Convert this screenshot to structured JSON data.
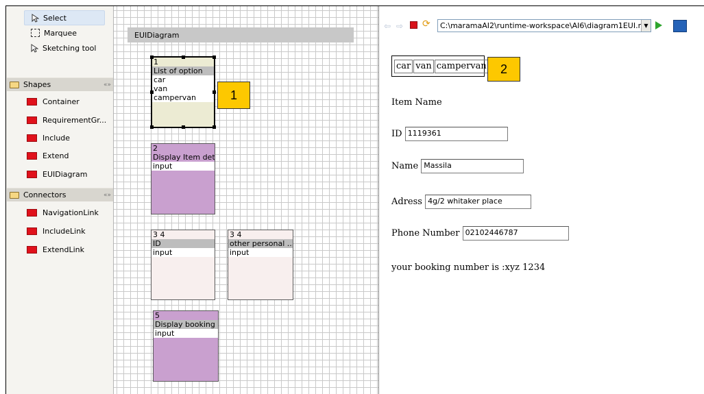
{
  "palette": {
    "tools": [
      {
        "label": "Select",
        "icon": "cursor-icon"
      },
      {
        "label": "Marquee",
        "icon": "marquee-icon"
      },
      {
        "label": "Sketching tool",
        "icon": "cursor-icon"
      }
    ],
    "shapes_drawer": "Shapes",
    "shapes": [
      "Container",
      "RequirementGr...",
      "Include",
      "Extend",
      "EUIDiagram"
    ],
    "connectors_drawer": "Connectors",
    "connectors": [
      "NavigationLink",
      "IncludeLink",
      "ExtendLink"
    ],
    "drawer_chevron": "«»"
  },
  "canvas": {
    "diagram_title": "EUIDiagram",
    "nodes": {
      "n1": {
        "id": "1",
        "title": "List of option",
        "items": [
          "car",
          "van",
          "campervan"
        ]
      },
      "n2": {
        "id": "2",
        "title": "Display Item detail",
        "field": "input"
      },
      "n3": {
        "id": "3 4",
        "title": "ID",
        "field": "input"
      },
      "n4": {
        "id": "3 4",
        "title": "other personal ...",
        "field": "input"
      },
      "n5": {
        "id": "5",
        "title": "Display booking",
        "field": "input"
      }
    },
    "callout": "1"
  },
  "browser": {
    "url": "C:\\maramaAI2\\runtime-workspace\\AI6\\diagram1EUI.m",
    "options": [
      "car",
      "van",
      "campervan"
    ],
    "callout": "2",
    "item_name": "Item Name",
    "id_label": "ID",
    "id_value": "1119361",
    "name_label": "Name",
    "name_value": "Massila",
    "address_label": "Adress",
    "address_value": "4g/2 whitaker place",
    "phone_label": "Phone Number",
    "phone_value": "02102446787",
    "booking_text": "your booking number is :xyz 1234"
  },
  "colors": {
    "accent": "#fdc800",
    "node_purple": "#c9a0cf",
    "node_pink": "#f8efee",
    "palette_red": "#e0111b"
  }
}
